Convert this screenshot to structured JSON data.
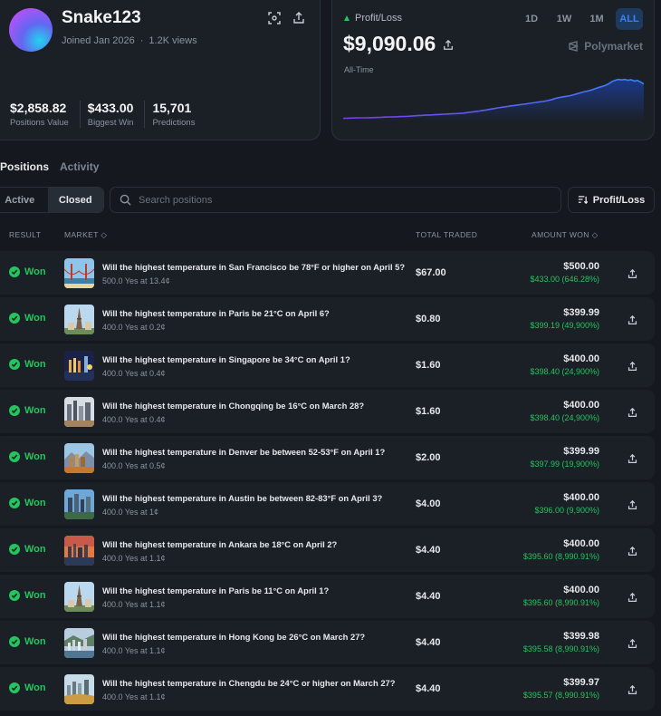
{
  "profile": {
    "username": "Snake123",
    "joined": "Joined Jan 2026",
    "views": "1.2K views",
    "stats": [
      {
        "value": "$2,858.82",
        "label": "Positions Value"
      },
      {
        "value": "$433.00",
        "label": "Biggest Win"
      },
      {
        "value": "15,701",
        "label": "Predictions"
      }
    ]
  },
  "pnl": {
    "label": "Profit/Loss",
    "value": "$9,090.06",
    "period": "All-Time",
    "ranges": [
      "1D",
      "1W",
      "1M",
      "ALL"
    ],
    "active_range": "ALL",
    "brand": "Polymarket",
    "colors": {
      "line_start": "#7c3aed",
      "line_end": "#3b82f6",
      "fill": "#1d4ed8"
    }
  },
  "chart_data": {
    "type": "area",
    "title": "",
    "xlabel": "",
    "ylabel": "",
    "values": [
      -400,
      -350,
      -330,
      -300,
      -280,
      -260,
      -255,
      -240,
      -220,
      -200,
      -180,
      -150,
      -120,
      -60,
      -20,
      10,
      30,
      60,
      90,
      120,
      150,
      200,
      280,
      330,
      390,
      430,
      480,
      520,
      560,
      610,
      640,
      700,
      760,
      800,
      860,
      900,
      930,
      980,
      1060,
      1180,
      1300,
      1400,
      1520,
      1620,
      1780,
      1900,
      2050,
      2200,
      2350,
      2500,
      2650,
      2780,
      2900,
      3050,
      3150,
      3280,
      3400,
      3500,
      3600,
      3750,
      3880,
      4000,
      4150,
      4250,
      4400,
      4600,
      4800,
      5100,
      5300,
      5450,
      5600,
      5750,
      5900,
      6150,
      6400,
      6650,
      6900,
      7100,
      7300,
      7600,
      7900,
      8200,
      8450,
      8750,
      9200,
      9800,
      10100,
      10350,
      10200,
      10350,
      10100,
      10250,
      9900,
      10050,
      9600,
      9090
    ],
    "ylim": [
      -500,
      10500
    ],
    "grid": false
  },
  "tabs": {
    "positions": "Positions",
    "activity": "Activity"
  },
  "filters": {
    "active": "Active",
    "closed": "Closed",
    "search_placeholder": "Search positions",
    "sort_label": "Profit/Loss"
  },
  "table": {
    "headers": {
      "result": "RESULT",
      "market": "MARKET",
      "traded": "TOTAL TRADED",
      "won": "AMOUNT WON"
    },
    "rows": [
      {
        "result": "Won",
        "title": "Will the highest temperature in San Francisco be 78°F or higher on April 5?",
        "sub": "500.0 Yes at 13.4¢",
        "traded": "$67.00",
        "won": "$500.00",
        "profit": "$433.00 (646.28%)",
        "thumb": "sanfrancisco"
      },
      {
        "result": "Won",
        "title": "Will the highest temperature in Paris be 21°C on April 6?",
        "sub": "400.0 Yes at 0.2¢",
        "traded": "$0.80",
        "won": "$399.99",
        "profit": "$399.19 (49,900%)",
        "thumb": "paris"
      },
      {
        "result": "Won",
        "title": "Will the highest temperature in Singapore be 34°C on April 1?",
        "sub": "400.0 Yes at 0.4¢",
        "traded": "$1.60",
        "won": "$400.00",
        "profit": "$398.40 (24,900%)",
        "thumb": "singapore"
      },
      {
        "result": "Won",
        "title": "Will the highest temperature in Chongqing be 16°C on March 28?",
        "sub": "400.0 Yes at 0.4¢",
        "traded": "$1.60",
        "won": "$400.00",
        "profit": "$398.40 (24,900%)",
        "thumb": "chongqing"
      },
      {
        "result": "Won",
        "title": "Will the highest temperature in Denver be between 52-53°F on April 1?",
        "sub": "400.0 Yes at 0.5¢",
        "traded": "$2.00",
        "won": "$399.99",
        "profit": "$397.99 (19,900%)",
        "thumb": "denver"
      },
      {
        "result": "Won",
        "title": "Will the highest temperature in Austin be between 82-83°F on April 3?",
        "sub": "400.0 Yes at 1¢",
        "traded": "$4.00",
        "won": "$400.00",
        "profit": "$396.00 (9,900%)",
        "thumb": "austin"
      },
      {
        "result": "Won",
        "title": "Will the highest temperature in Ankara be 18°C on April 2?",
        "sub": "400.0 Yes at 1.1¢",
        "traded": "$4.40",
        "won": "$400.00",
        "profit": "$395.60 (8,990.91%)",
        "thumb": "ankara"
      },
      {
        "result": "Won",
        "title": "Will the highest temperature in Paris be 11°C on April 1?",
        "sub": "400.0 Yes at 1.1¢",
        "traded": "$4.40",
        "won": "$400.00",
        "profit": "$395.60 (8,990.91%)",
        "thumb": "paris"
      },
      {
        "result": "Won",
        "title": "Will the highest temperature in Hong Kong be 26°C on March 27?",
        "sub": "400.0 Yes at 1.1¢",
        "traded": "$4.40",
        "won": "$399.98",
        "profit": "$395.58 (8,990.91%)",
        "thumb": "hongkong"
      },
      {
        "result": "Won",
        "title": "Will the highest temperature in Chengdu be 24°C or higher on March 27?",
        "sub": "400.0 Yes at 1.1¢",
        "traded": "$4.40",
        "won": "$399.97",
        "profit": "$395.57 (8,990.91%)",
        "thumb": "chengdu"
      }
    ]
  }
}
